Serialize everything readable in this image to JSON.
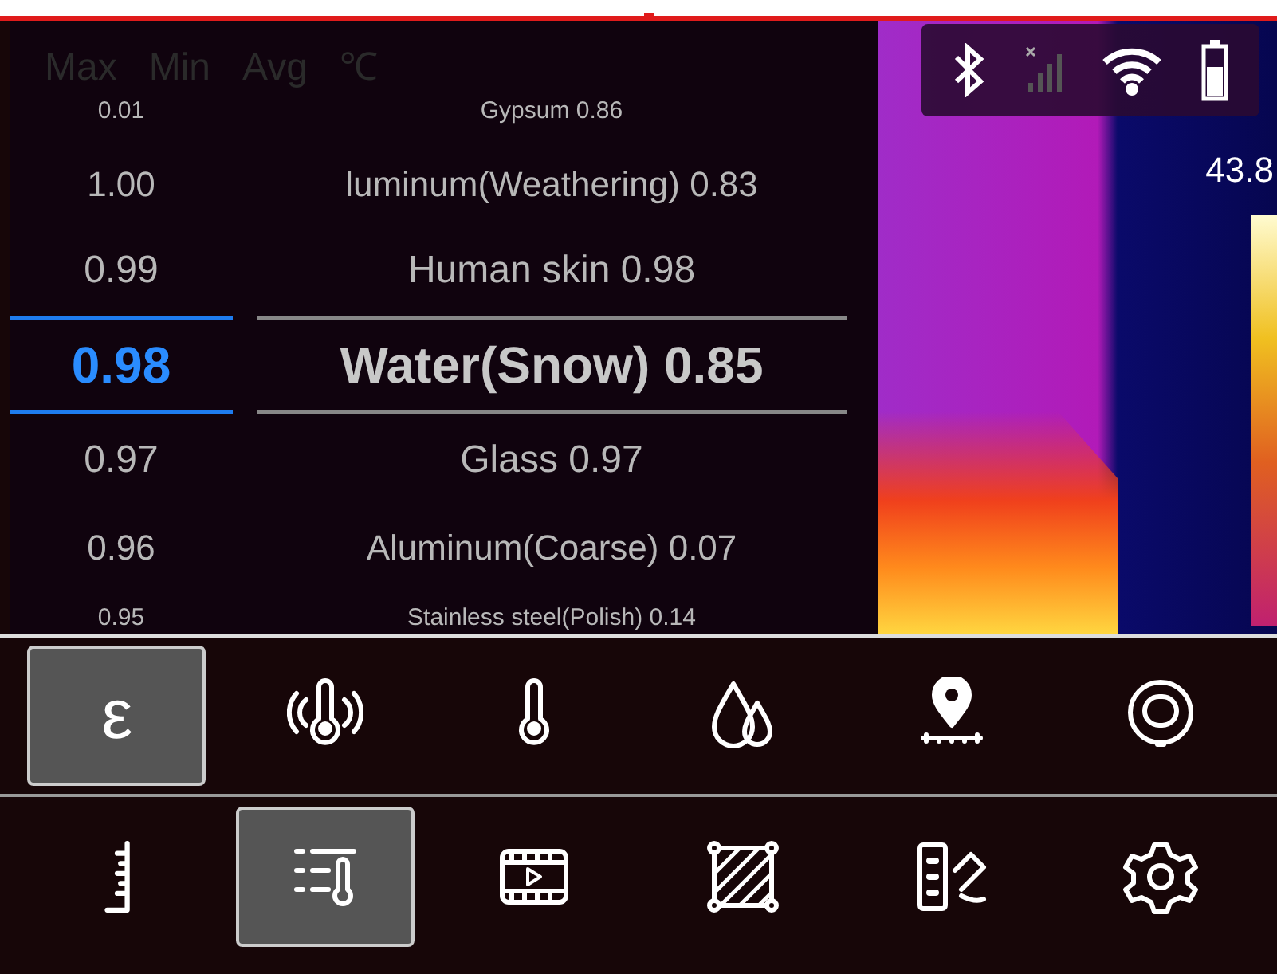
{
  "header": {
    "labels": [
      "Max",
      "Min",
      "Avg",
      "℃"
    ]
  },
  "emissivity_picker": {
    "rows": [
      {
        "value": "0.01",
        "material": "Gypsum 0.86",
        "selected": false
      },
      {
        "value": "1.00",
        "material": "luminum(Weathering) 0.83",
        "selected": false
      },
      {
        "value": "0.99",
        "material": "Human skin 0.98",
        "selected": false
      },
      {
        "value": "0.98",
        "material": "Water(Snow) 0.85",
        "selected": true
      },
      {
        "value": "0.97",
        "material": "Glass 0.97",
        "selected": false
      },
      {
        "value": "0.96",
        "material": "Aluminum(Coarse) 0.07",
        "selected": false
      },
      {
        "value": "0.95",
        "material": "Stainless steel(Polish) 0.14",
        "selected": false
      }
    ]
  },
  "scale": {
    "max": "43.8"
  },
  "toolbar_rows": [
    [
      {
        "kind": "epsilon",
        "glyph": "ε",
        "selected": true
      },
      {
        "kind": "reflected-temp",
        "selected": false
      },
      {
        "kind": "thermometer",
        "selected": false
      },
      {
        "kind": "humidity",
        "selected": false
      },
      {
        "kind": "distance",
        "selected": false
      },
      {
        "kind": "lens",
        "selected": false
      }
    ],
    [
      {
        "kind": "ruler",
        "selected": false
      },
      {
        "kind": "parameters",
        "selected": true
      },
      {
        "kind": "video",
        "selected": false
      },
      {
        "kind": "area",
        "selected": false
      },
      {
        "kind": "palette",
        "selected": false
      },
      {
        "kind": "settings",
        "selected": false
      }
    ]
  ]
}
